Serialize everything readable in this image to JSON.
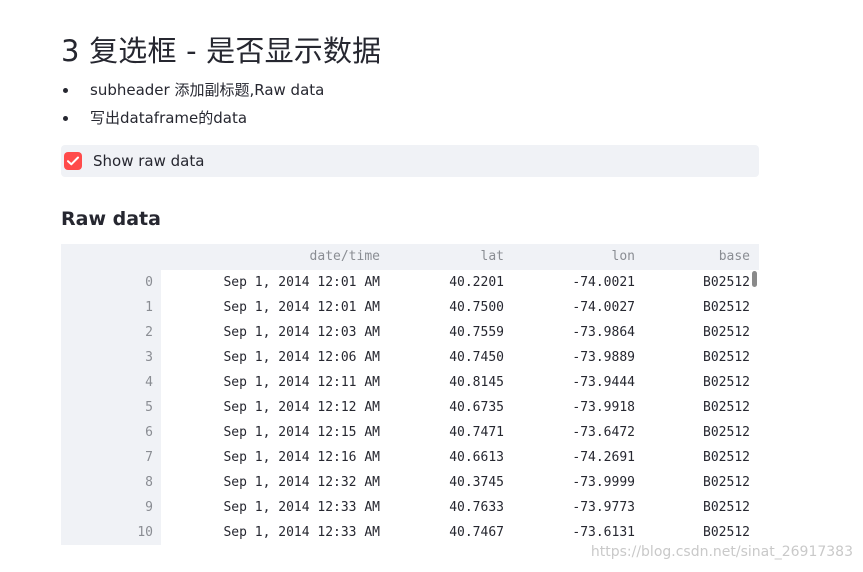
{
  "heading": "3 复选框 - 是否显示数据",
  "bullets": [
    "subheader 添加副标题,Raw data",
    "写出dataframe的data"
  ],
  "checkbox": {
    "label": "Show raw data",
    "checked": true,
    "accent_color": "#ff4b4b"
  },
  "subheader": "Raw data",
  "table": {
    "columns": [
      "date/time",
      "lat",
      "lon",
      "base"
    ],
    "rows": [
      {
        "index": "0",
        "datetime": "Sep 1, 2014 12:01 AM",
        "lat": "40.2201",
        "lon": "-74.0021",
        "base": "B02512"
      },
      {
        "index": "1",
        "datetime": "Sep 1, 2014 12:01 AM",
        "lat": "40.7500",
        "lon": "-74.0027",
        "base": "B02512"
      },
      {
        "index": "2",
        "datetime": "Sep 1, 2014 12:03 AM",
        "lat": "40.7559",
        "lon": "-73.9864",
        "base": "B02512"
      },
      {
        "index": "3",
        "datetime": "Sep 1, 2014 12:06 AM",
        "lat": "40.7450",
        "lon": "-73.9889",
        "base": "B02512"
      },
      {
        "index": "4",
        "datetime": "Sep 1, 2014 12:11 AM",
        "lat": "40.8145",
        "lon": "-73.9444",
        "base": "B02512"
      },
      {
        "index": "5",
        "datetime": "Sep 1, 2014 12:12 AM",
        "lat": "40.6735",
        "lon": "-73.9918",
        "base": "B02512"
      },
      {
        "index": "6",
        "datetime": "Sep 1, 2014 12:15 AM",
        "lat": "40.7471",
        "lon": "-73.6472",
        "base": "B02512"
      },
      {
        "index": "7",
        "datetime": "Sep 1, 2014 12:16 AM",
        "lat": "40.6613",
        "lon": "-74.2691",
        "base": "B02512"
      },
      {
        "index": "8",
        "datetime": "Sep 1, 2014 12:32 AM",
        "lat": "40.3745",
        "lon": "-73.9999",
        "base": "B02512"
      },
      {
        "index": "9",
        "datetime": "Sep 1, 2014 12:33 AM",
        "lat": "40.7633",
        "lon": "-73.9773",
        "base": "B02512"
      },
      {
        "index": "10",
        "datetime": "Sep 1, 2014 12:33 AM",
        "lat": "40.7467",
        "lon": "-73.6131",
        "base": "B02512"
      }
    ]
  },
  "watermark": "https://blog.csdn.net/sinat_26917383"
}
